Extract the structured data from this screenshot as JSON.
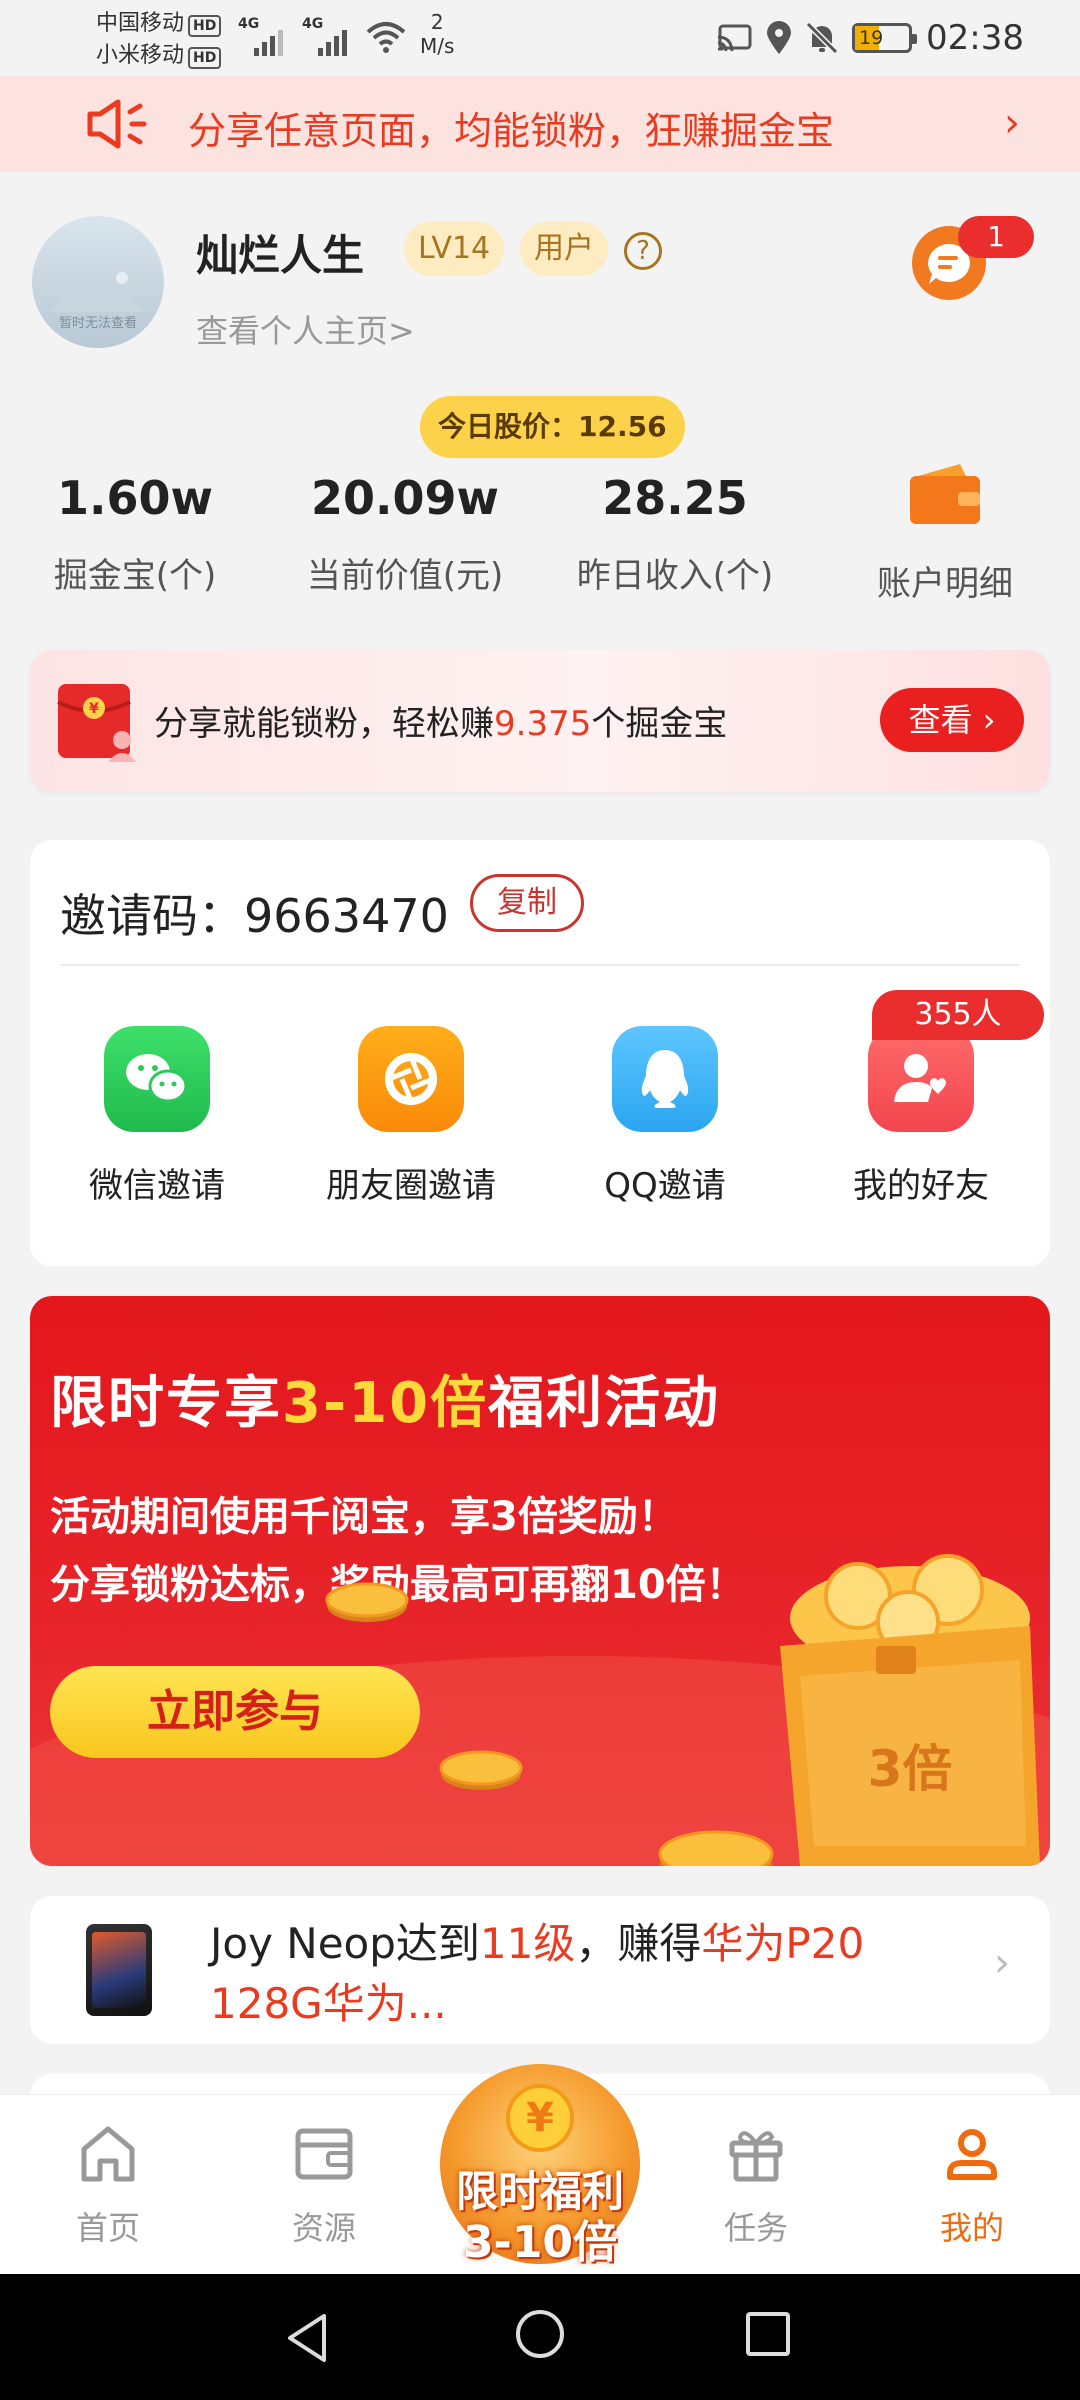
{
  "status_bar": {
    "carrier_1": "中国移动",
    "carrier_2": "小米移动",
    "hd": "HD",
    "net_1": "4G",
    "net_2": "4G",
    "speed_value": "2",
    "speed_unit": "M/s",
    "battery": "19",
    "time": "02:38"
  },
  "promo_strip": {
    "text": "分享任意页面，均能锁粉，狂赚掘金宝",
    "icon": "megaphone-icon"
  },
  "profile": {
    "avatar_caption": "暂时无法查看",
    "username": "灿烂人生",
    "level": "LV14",
    "role": "用户",
    "help_icon": "?",
    "profile_link": "查看个人主页>",
    "message_badge": "1"
  },
  "stats": {
    "stock_price": "今日股价：12.56",
    "items": [
      {
        "value": "1.60w",
        "label": "掘金宝(个)"
      },
      {
        "value": "20.09w",
        "label": "当前价值(元)"
      },
      {
        "value": "28.25",
        "label": "昨日收入(个)"
      }
    ],
    "account_detail": "账户明细"
  },
  "share_card": {
    "prefix": "分享就能锁粉，轻松赚",
    "amount": "9.375",
    "suffix": "个掘金宝",
    "button": "查看"
  },
  "invite": {
    "code_label": "邀请码：",
    "code": "9663470",
    "copy": "复制",
    "items": [
      {
        "label": "微信邀请",
        "icon": "wechat-icon"
      },
      {
        "label": "朋友圈邀请",
        "icon": "moments-icon"
      },
      {
        "label": "QQ邀请",
        "icon": "qq-icon"
      },
      {
        "label": "我的好友",
        "icon": "friends-icon"
      }
    ],
    "friend_count": "355人"
  },
  "banner": {
    "title_a": "限时专享",
    "title_b": "3-10倍",
    "title_c": "福利活动",
    "line1": "活动期间使用千阅宝，享3倍奖励！",
    "line2": "分享锁粉达标，奖励最高可再翻10倍！",
    "button": "立即参与",
    "chest_label": "3倍"
  },
  "achievement": {
    "name": "Joy Neop",
    "text_1": "达到",
    "level": "11级",
    "text_2": "，赚得",
    "prize": "华为P20 128G华为..."
  },
  "bottom_nav": {
    "items": [
      {
        "label": "首页",
        "icon": "home-icon"
      },
      {
        "label": "资源",
        "icon": "wallet-icon"
      },
      {
        "label": "任务",
        "icon": "gift-icon"
      },
      {
        "label": "我的",
        "icon": "user-icon"
      }
    ],
    "center_line1": "限时福利",
    "center_line2": "3-10倍",
    "center_coin": "¥"
  },
  "colors": {
    "accent": "#ea3a1f",
    "active_tab": "#f06a0f",
    "stock_pill": "#fcd24a"
  }
}
